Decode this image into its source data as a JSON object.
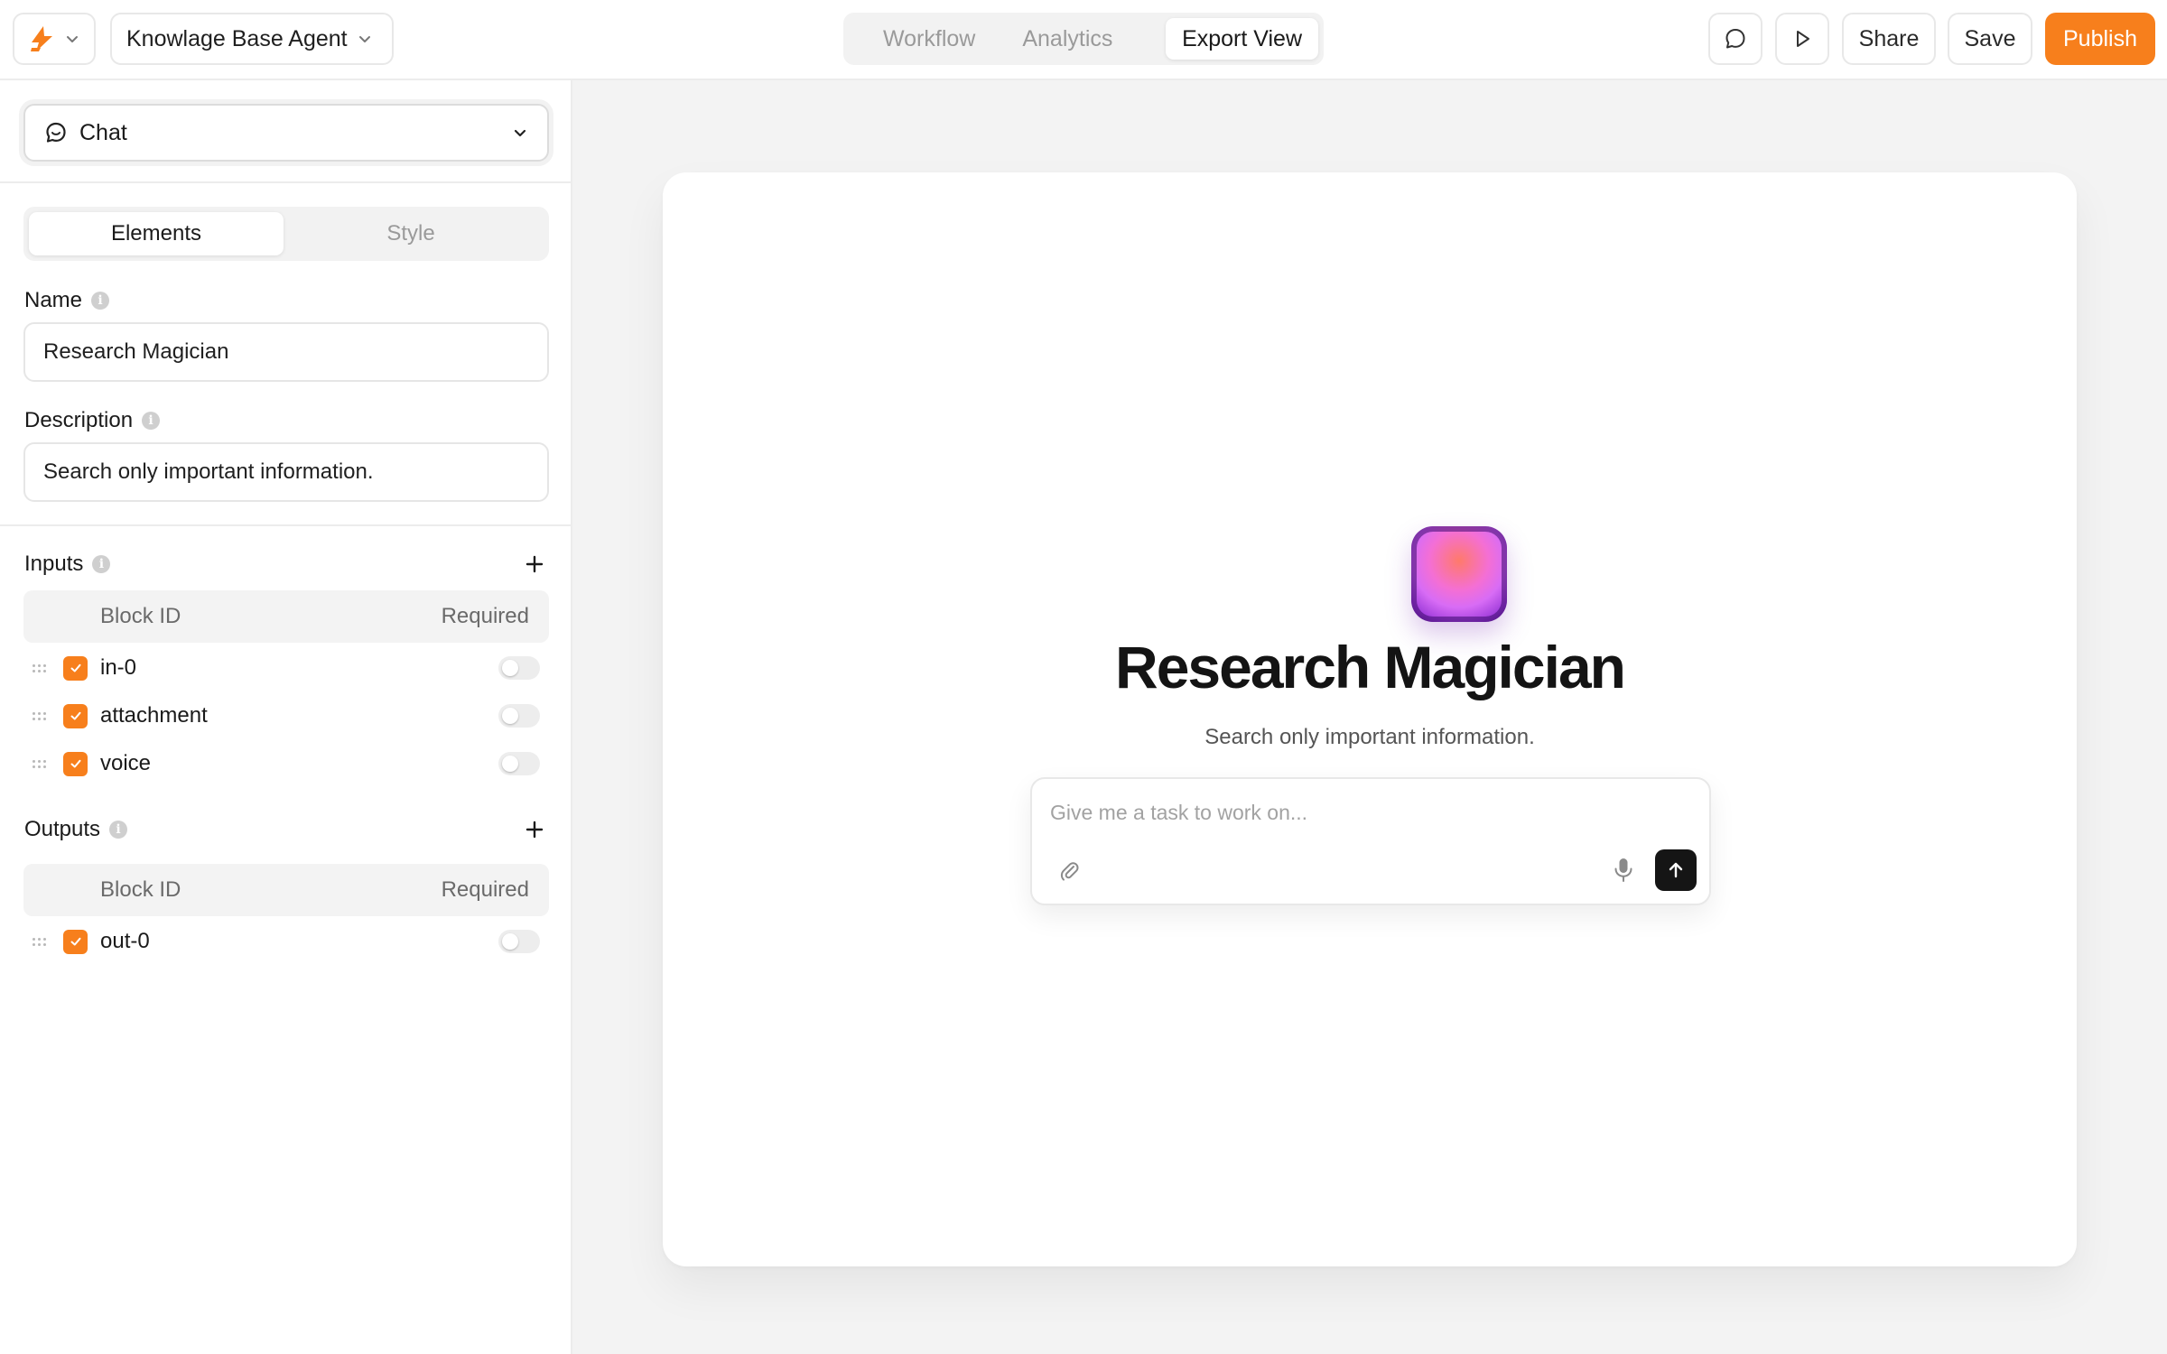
{
  "header": {
    "agent_name": "Knowlage Base Agent",
    "tabs": [
      {
        "label": "Workflow",
        "active": false
      },
      {
        "label": "Analytics",
        "active": false
      },
      {
        "label": "Export View",
        "active": true
      }
    ],
    "share_label": "Share",
    "save_label": "Save",
    "publish_label": "Publish"
  },
  "colors": {
    "accent": "#f77f1c",
    "send_button": "#151515"
  },
  "sidebar": {
    "mode": "Chat",
    "segments": [
      {
        "label": "Elements",
        "active": true
      },
      {
        "label": "Style",
        "active": false
      }
    ],
    "name_label": "Name",
    "name_value": "Research Magician",
    "description_label": "Description",
    "description_value": "Search only important information.",
    "inputs": {
      "title": "Inputs",
      "col_block_id": "Block ID",
      "col_required": "Required",
      "rows": [
        {
          "id": "in-0",
          "checked": true,
          "required": false
        },
        {
          "id": "attachment",
          "checked": true,
          "required": false
        },
        {
          "id": "voice",
          "checked": true,
          "required": false
        }
      ]
    },
    "outputs": {
      "title": "Outputs",
      "col_block_id": "Block ID",
      "col_required": "Required",
      "rows": [
        {
          "id": "out-0",
          "checked": true,
          "required": false
        }
      ]
    }
  },
  "preview": {
    "title": "Research Magician",
    "description": "Search only important information.",
    "chat_placeholder": "Give me a task to work on..."
  }
}
